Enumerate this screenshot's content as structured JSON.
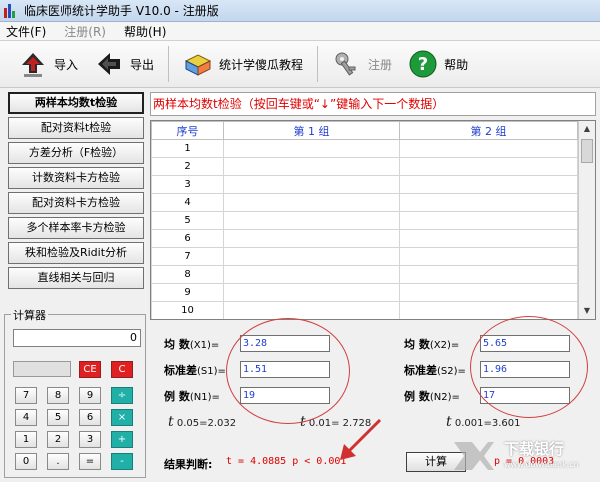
{
  "window": {
    "title": "临床医师统计学助手 V10.0 - 注册版"
  },
  "menu": {
    "file": "文件(F)",
    "register": "注册(R)",
    "help": "帮助(H)"
  },
  "toolbar": {
    "import": "导入",
    "export": "导出",
    "tutorial": "统计学傻瓜教程",
    "register": "注册",
    "help": "帮助"
  },
  "methods": [
    "两样本均数t检验",
    "配对资料t检验",
    "方差分析（F检验）",
    "计数资料卡方检验",
    "配对资料卡方检验",
    "多个样本率卡方检验",
    "秩和检验及Ridit分析",
    "直线相关与回归"
  ],
  "hint": "两样本均数t检验（按回车键或“↓”键输入下一个数据）",
  "grid": {
    "headers": [
      "序号",
      "第 1 组",
      "第 2 组"
    ],
    "rows": [
      "1",
      "2",
      "3",
      "4",
      "5",
      "6",
      "7",
      "8",
      "9",
      "10"
    ]
  },
  "stats": {
    "mean1_label": "均  数",
    "mean1_sub": "(X1)=",
    "sd1_label": "标准差",
    "sd1_sub": "(S1)=",
    "n1_label": "例  数",
    "n1_sub": "(N1)=",
    "mean2_label": "均  数",
    "mean2_sub": "(X2)=",
    "sd2_label": "标准差",
    "sd2_sub": "(S2)=",
    "n2_label": "例  数",
    "n2_sub": "(N2)=",
    "mean1": "3.28",
    "sd1": "1.51",
    "n1": "19",
    "mean2": "5.65",
    "sd2": "1.96",
    "n2": "17",
    "t005": "0.05=2.032",
    "t001": "0.01= 2.728",
    "t0001": "0.001=3.601",
    "t_symbol": "t",
    "result_label": "结果判断:",
    "result_text": "t = 4.0885  p < 0.001",
    "calc_button": "计算",
    "p_text": "p = 0.0003"
  },
  "calculator": {
    "title": "计算器",
    "display": "0",
    "keys": [
      "CE",
      "C",
      "7",
      "8",
      "9",
      "÷",
      "4",
      "5",
      "6",
      "×",
      "1",
      "2",
      "3",
      "+",
      "0",
      ".",
      "=",
      "-"
    ]
  },
  "watermark": {
    "brand": "下载银行",
    "url": "www.downbank.cn"
  },
  "colors": {
    "accent_red": "#e00000",
    "accent_blue": "#1f3fcf",
    "teal": "#20b0a8"
  }
}
